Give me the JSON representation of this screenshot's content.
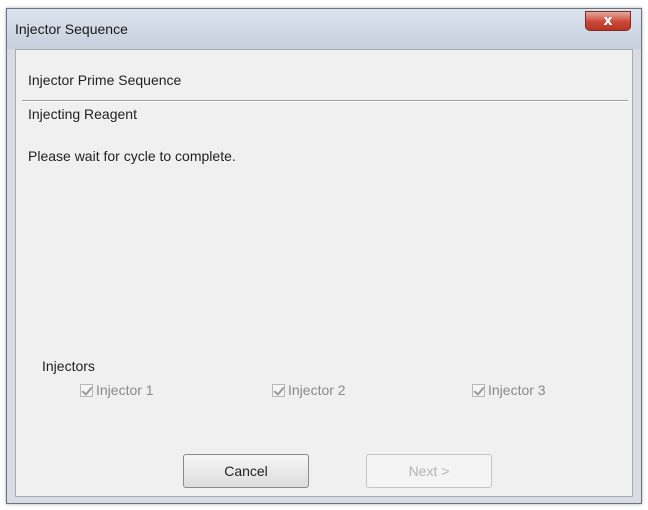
{
  "window": {
    "title": "Injector Sequence",
    "close_label": "x"
  },
  "dialog": {
    "sequence_title": "Injector Prime Sequence",
    "step_title": "Injecting Reagent",
    "message": "Please wait for cycle to complete."
  },
  "injectors": {
    "group_label": "Injectors",
    "items": [
      {
        "label": "Injector 1",
        "checked": true,
        "enabled": false
      },
      {
        "label": "Injector 2",
        "checked": true,
        "enabled": false
      },
      {
        "label": "Injector 3",
        "checked": true,
        "enabled": false
      }
    ]
  },
  "buttons": {
    "cancel_label": "Cancel",
    "next_label": "Next >",
    "next_enabled": false
  }
}
